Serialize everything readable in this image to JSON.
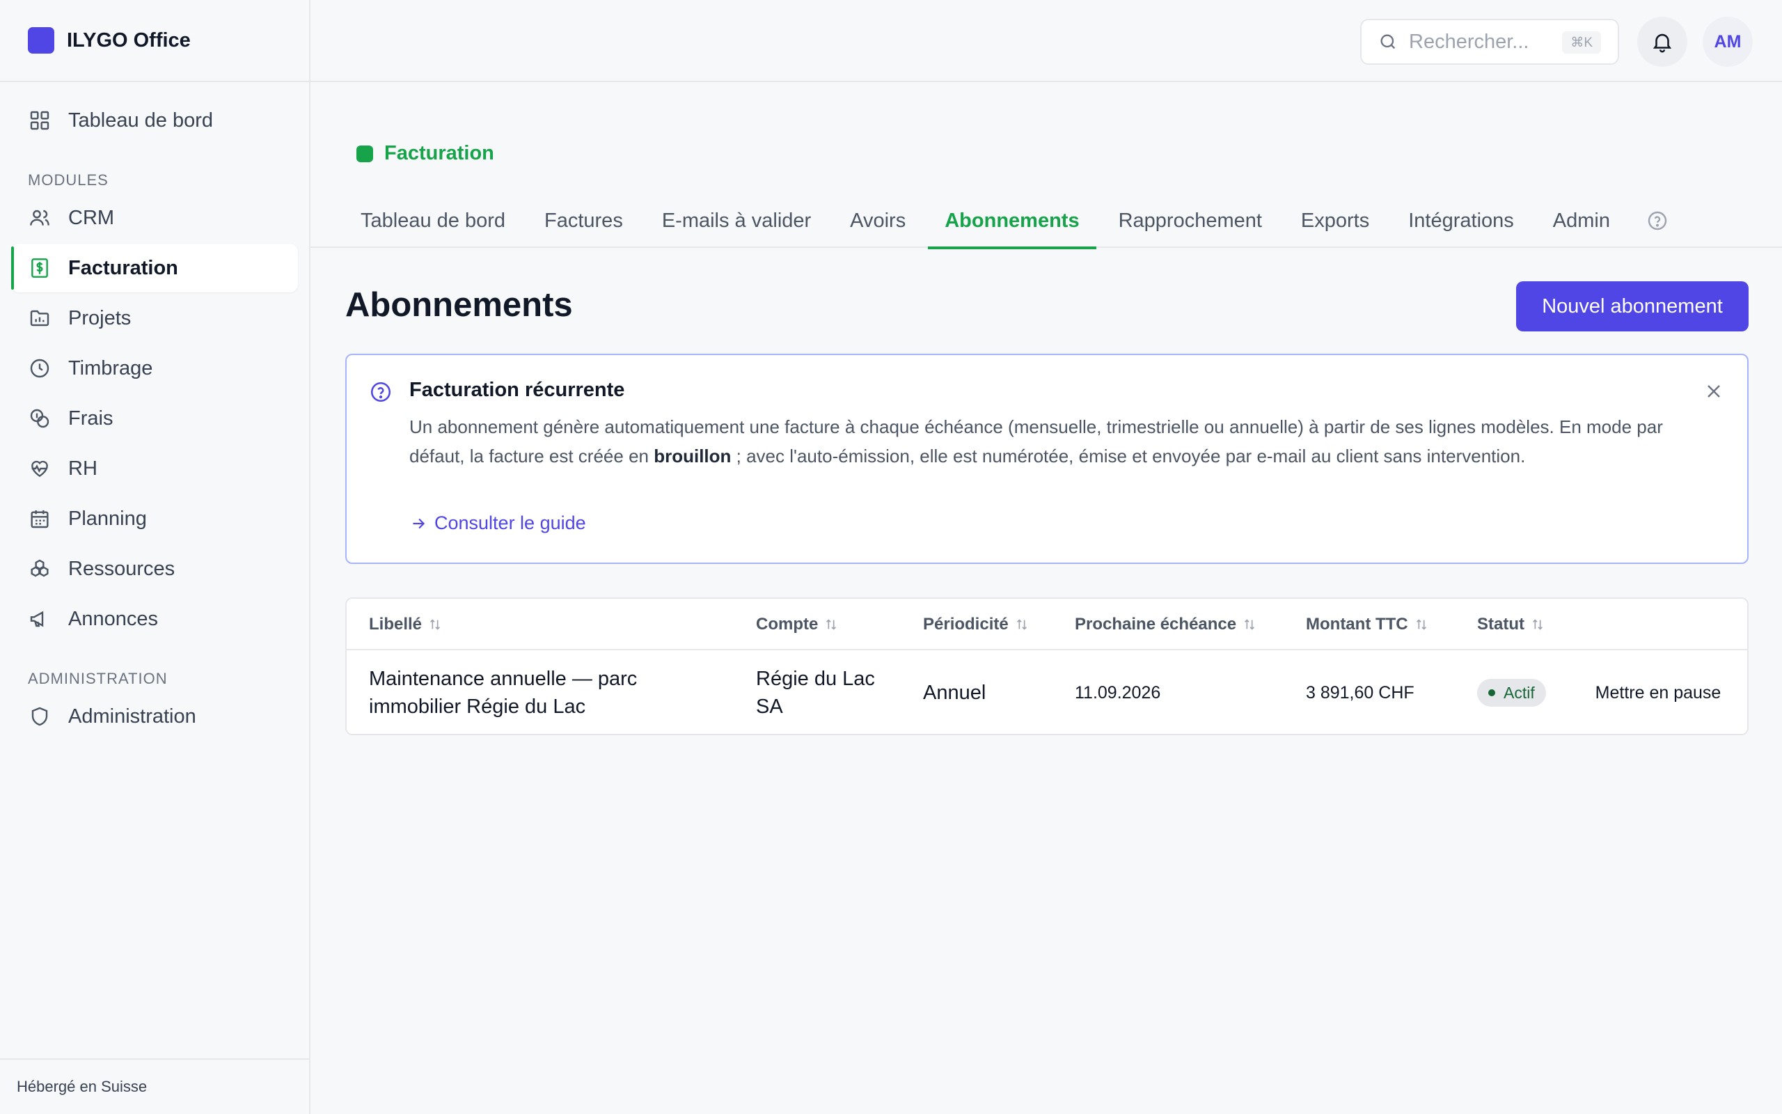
{
  "app": {
    "name": "ILYGO Office",
    "brand_color": "#4f46e5",
    "accent_color": "#16a34a"
  },
  "sidebar": {
    "dashboard": {
      "label": "Tableau de bord",
      "icon": "grid-icon"
    },
    "modules_label": "MODULES",
    "modules": [
      {
        "label": "CRM",
        "icon": "users-icon"
      },
      {
        "label": "Facturation",
        "icon": "invoice-dollar-icon",
        "active": true
      },
      {
        "label": "Projets",
        "icon": "folder-chart-icon"
      },
      {
        "label": "Timbrage",
        "icon": "clock-icon"
      },
      {
        "label": "Frais",
        "icon": "coins-icon"
      },
      {
        "label": "RH",
        "icon": "heart-pulse-icon"
      },
      {
        "label": "Planning",
        "icon": "calendar-icon"
      },
      {
        "label": "Ressources",
        "icon": "boxes-icon"
      },
      {
        "label": "Annonces",
        "icon": "megaphone-icon"
      }
    ],
    "admin_label": "ADMINISTRATION",
    "admin": {
      "label": "Administration",
      "icon": "shield-icon"
    },
    "footer": "Hébergé en Suisse"
  },
  "header": {
    "search_placeholder": "Rechercher...",
    "search_shortcut": "⌘K",
    "avatar_initials": "AM"
  },
  "module": {
    "title": "Facturation",
    "tabs": [
      {
        "label": "Tableau de bord"
      },
      {
        "label": "Factures"
      },
      {
        "label": "E-mails à valider"
      },
      {
        "label": "Avoirs"
      },
      {
        "label": "Abonnements",
        "active": true
      },
      {
        "label": "Rapprochement"
      },
      {
        "label": "Exports"
      },
      {
        "label": "Intégrations"
      },
      {
        "label": "Admin"
      }
    ]
  },
  "page": {
    "title": "Abonnements",
    "new_button": "Nouvel abonnement"
  },
  "info": {
    "title": "Facturation récurrente",
    "text_before": "Un abonnement génère automatiquement une facture à chaque échéance (mensuelle, trimestrielle ou annuelle) à partir de ses lignes modèles. En mode par défaut, la facture est créée en ",
    "text_bold": "brouillon",
    "text_after": " ; avec l'auto-émission, elle est numérotée, émise et envoyée par e-mail au client sans intervention.",
    "link": "Consulter le guide"
  },
  "table": {
    "columns": [
      "Libellé",
      "Compte",
      "Périodicité",
      "Prochaine échéance",
      "Montant TTC",
      "Statut"
    ],
    "rows": [
      {
        "libelle": "Maintenance annuelle — parc immobilier Régie du Lac",
        "compte": "Régie du Lac SA",
        "periodicite": "Annuel",
        "echeance": "11.09.2026",
        "montant": "3 891,60 CHF",
        "statut": "Actif",
        "action": "Mettre en pause"
      }
    ]
  }
}
